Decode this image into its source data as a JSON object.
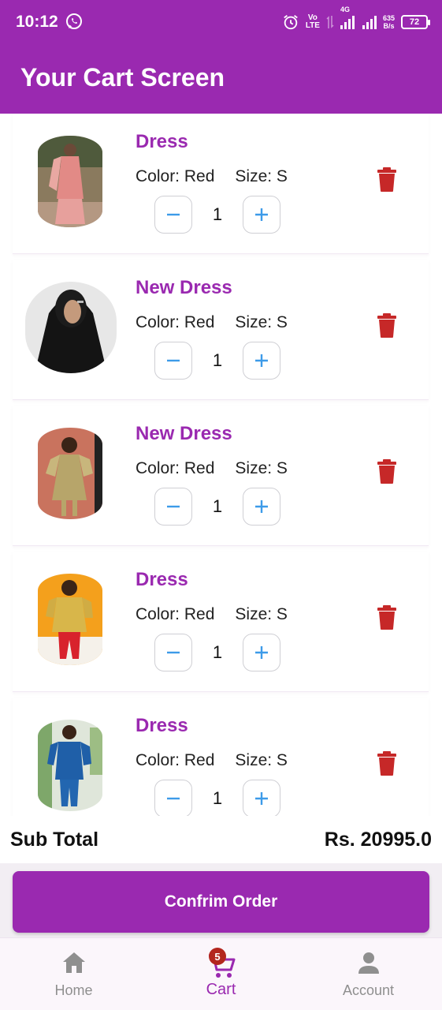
{
  "status_bar": {
    "time": "10:12",
    "volte_top": "Vo",
    "volte_bottom": "LTE",
    "network": "4G",
    "speed_value": "635",
    "speed_unit": "B/s",
    "battery": "72"
  },
  "app_bar": {
    "title": "Your Cart Screen"
  },
  "cart": {
    "items": [
      {
        "name": "Dress",
        "color_label": "Color: Red",
        "size_label": "Size: S",
        "quantity": "1"
      },
      {
        "name": "New Dress",
        "color_label": "Color: Red",
        "size_label": "Size: S",
        "quantity": "1"
      },
      {
        "name": "New Dress",
        "color_label": "Color: Red",
        "size_label": "Size: S",
        "quantity": "1"
      },
      {
        "name": "Dress",
        "color_label": "Color: Red",
        "size_label": "Size: S",
        "quantity": "1"
      },
      {
        "name": "Dress",
        "color_label": "Color: Red",
        "size_label": "Size: S",
        "quantity": "1"
      }
    ]
  },
  "summary": {
    "label": "Sub Total",
    "amount": "Rs. 20995.0"
  },
  "confirm_button": {
    "label": "Confrim Order"
  },
  "bottom_nav": {
    "home": {
      "label": "Home",
      "icon": "home-icon"
    },
    "cart": {
      "label": "Cart",
      "icon": "cart-icon",
      "badge": "5"
    },
    "account": {
      "label": "Account",
      "icon": "person-icon"
    }
  },
  "colors": {
    "primary": "#9a29b0",
    "delete": "#c62828",
    "qty_icon": "#3d9be9",
    "badge": "#b3261e"
  }
}
